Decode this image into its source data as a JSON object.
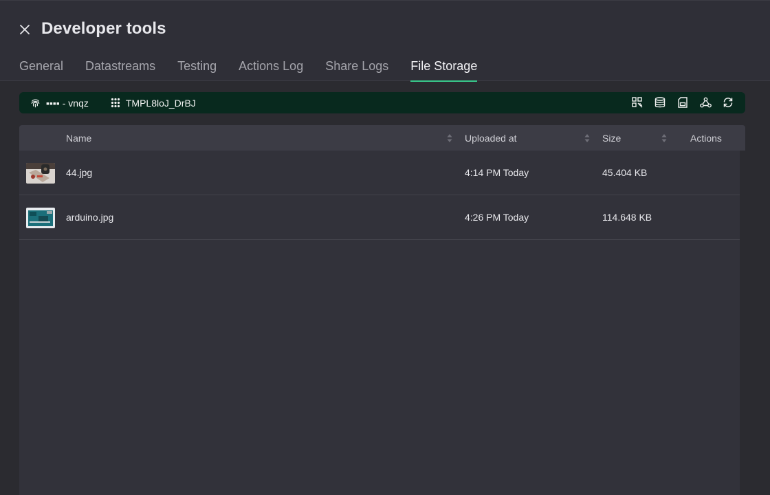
{
  "header": {
    "title": "Developer tools",
    "tabs": [
      {
        "label": "General"
      },
      {
        "label": "Datastreams"
      },
      {
        "label": "Testing"
      },
      {
        "label": "Actions Log"
      },
      {
        "label": "Share Logs"
      },
      {
        "label": "File Storage",
        "active": true
      }
    ]
  },
  "device_bar": {
    "device_name": "▪▪▪▪ - vnqz",
    "template_id": "TMPL8loJ_DrBJ",
    "icons": [
      "developer-mode-icon",
      "database-icon",
      "sd-card-icon",
      "webhook-icon",
      "refresh-icon"
    ]
  },
  "table": {
    "columns": [
      "Name",
      "Uploaded at",
      "Size",
      "Actions"
    ],
    "rows": [
      {
        "name": "44.jpg",
        "uploaded_at": "4:14 PM Today",
        "size": "45.404 KB"
      },
      {
        "name": "arduino.jpg",
        "uploaded_at": "4:26 PM Today",
        "size": "114.648 KB"
      }
    ]
  },
  "colors": {
    "accent": "#39c98b",
    "device_bar_bg": "#08291e",
    "page_bg": "#2b2b30"
  }
}
